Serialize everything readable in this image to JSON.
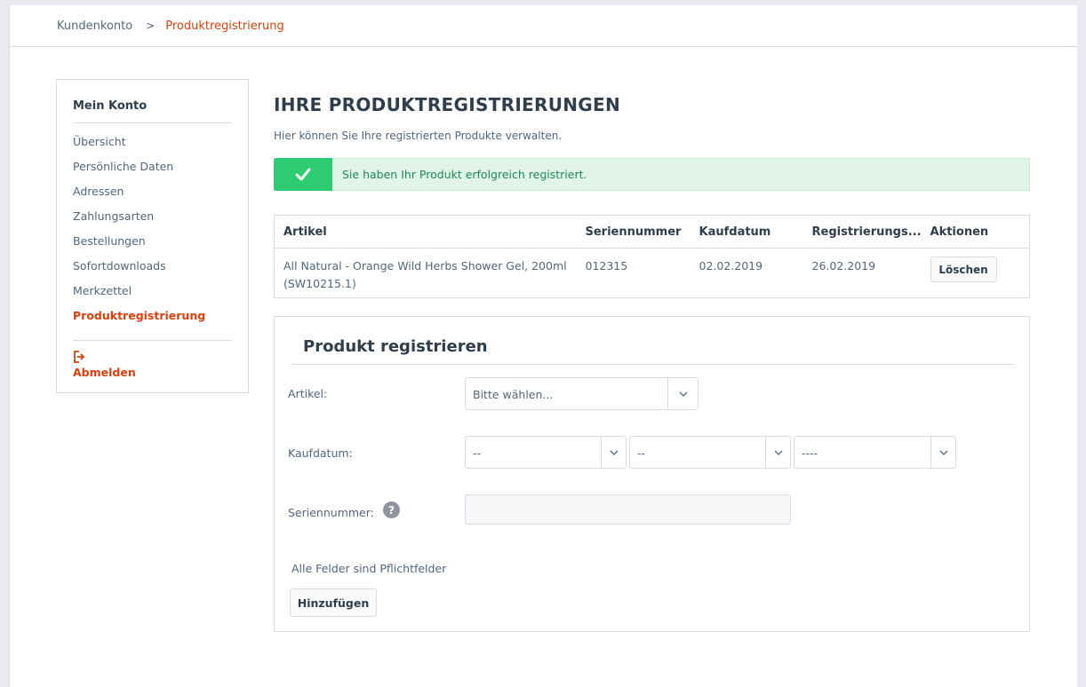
{
  "breadcrumb": {
    "home": "Kundenkonto",
    "separator": ">",
    "current": "Produktregistrierung"
  },
  "sidebar": {
    "title": "Mein Konto",
    "items": [
      {
        "label": "Übersicht",
        "active": false
      },
      {
        "label": "Persönliche Daten",
        "active": false
      },
      {
        "label": "Adressen",
        "active": false
      },
      {
        "label": "Zahlungsarten",
        "active": false
      },
      {
        "label": "Bestellungen",
        "active": false
      },
      {
        "label": "Sofortdownloads",
        "active": false
      },
      {
        "label": "Merkzettel",
        "active": false
      },
      {
        "label": "Produktregistrierung",
        "active": true
      }
    ],
    "logout_label": "Abmelden",
    "logout_icon": "logout-icon"
  },
  "main": {
    "title": "IHRE PRODUKTREGISTRIERUNGEN",
    "description": "Hier können Sie Ihre registrierten Produkte verwalten.",
    "alert": {
      "icon": "checkmark-icon",
      "text": "Sie haben Ihr Produkt erfolgreich registriert."
    },
    "table": {
      "headers": [
        "Artikel",
        "Seriennummer",
        "Kaufdatum",
        "Registrierungs...",
        "Aktionen"
      ],
      "rows": [
        {
          "article_line1": "All Natural - Orange Wild Herbs Shower Gel, 200ml",
          "article_line2": "(SW10215.1)",
          "serial": "012315",
          "purchase_date": "02.02.2019",
          "registration_date": "26.02.2019",
          "action_label": "Löschen"
        }
      ]
    },
    "form": {
      "title": "Produkt registrieren",
      "article_label": "Artikel:",
      "article_value": "Bitte wählen...",
      "date_label": "Kaufdatum:",
      "day_value": "--",
      "month_value": "--",
      "year_value": "----",
      "serial_label": "Seriennummer:",
      "serial_value": "",
      "help_icon": "?",
      "required_note": "Alle Felder sind Pflichtfelder",
      "submit_label": "Hinzufügen"
    }
  },
  "colors": {
    "accent": "#d9400b",
    "success": "#2ecc71",
    "success_bg": "#e0f4ea",
    "text": "#52667a",
    "heading": "#2f3e4c"
  }
}
